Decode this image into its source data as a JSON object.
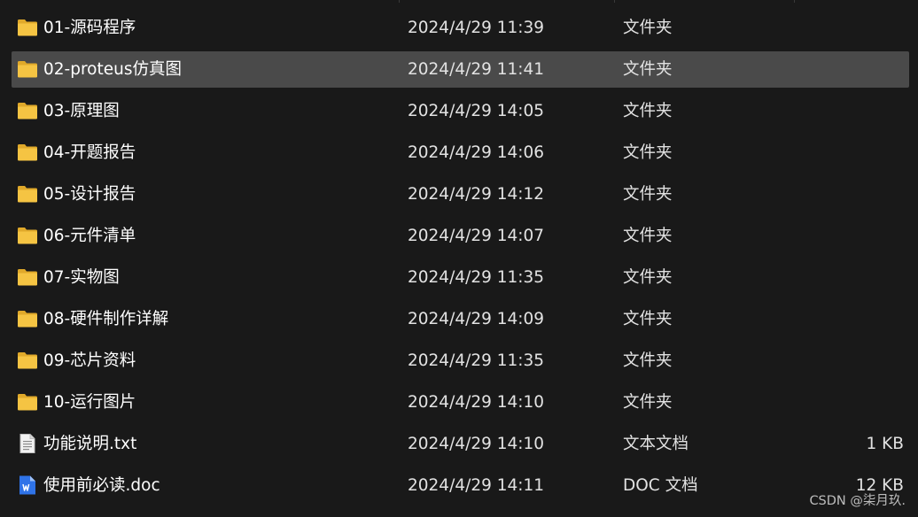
{
  "colors": {
    "background": "#191919",
    "selected_row": "#4a4a4a",
    "folder_icon": "#f5c443",
    "doc_icon": "#2f73e8"
  },
  "files": [
    {
      "name": "01-源码程序",
      "date": "2024/4/29 11:39",
      "type": "文件夹",
      "size": "",
      "icon": "folder-icon",
      "selected": false
    },
    {
      "name": "02-proteus仿真图",
      "date": "2024/4/29 11:41",
      "type": "文件夹",
      "size": "",
      "icon": "folder-icon",
      "selected": true
    },
    {
      "name": "03-原理图",
      "date": "2024/4/29 14:05",
      "type": "文件夹",
      "size": "",
      "icon": "folder-icon",
      "selected": false
    },
    {
      "name": "04-开题报告",
      "date": "2024/4/29 14:06",
      "type": "文件夹",
      "size": "",
      "icon": "folder-icon",
      "selected": false
    },
    {
      "name": "05-设计报告",
      "date": "2024/4/29 14:12",
      "type": "文件夹",
      "size": "",
      "icon": "folder-icon",
      "selected": false
    },
    {
      "name": "06-元件清单",
      "date": "2024/4/29 14:07",
      "type": "文件夹",
      "size": "",
      "icon": "folder-icon",
      "selected": false
    },
    {
      "name": "07-实物图",
      "date": "2024/4/29 11:35",
      "type": "文件夹",
      "size": "",
      "icon": "folder-icon",
      "selected": false
    },
    {
      "name": "08-硬件制作详解",
      "date": "2024/4/29 14:09",
      "type": "文件夹",
      "size": "",
      "icon": "folder-icon",
      "selected": false
    },
    {
      "name": "09-芯片资料",
      "date": "2024/4/29 11:35",
      "type": "文件夹",
      "size": "",
      "icon": "folder-icon",
      "selected": false
    },
    {
      "name": "10-运行图片",
      "date": "2024/4/29 14:10",
      "type": "文件夹",
      "size": "",
      "icon": "folder-icon",
      "selected": false
    },
    {
      "name": "功能说明.txt",
      "date": "2024/4/29 14:10",
      "type": "文本文档",
      "size": "1 KB",
      "icon": "text-file-icon",
      "selected": false
    },
    {
      "name": "使用前必读.doc",
      "date": "2024/4/29 14:11",
      "type": "DOC 文档",
      "size": "12 KB",
      "icon": "word-doc-icon",
      "selected": false
    }
  ],
  "watermark": "CSDN @柒月玖."
}
